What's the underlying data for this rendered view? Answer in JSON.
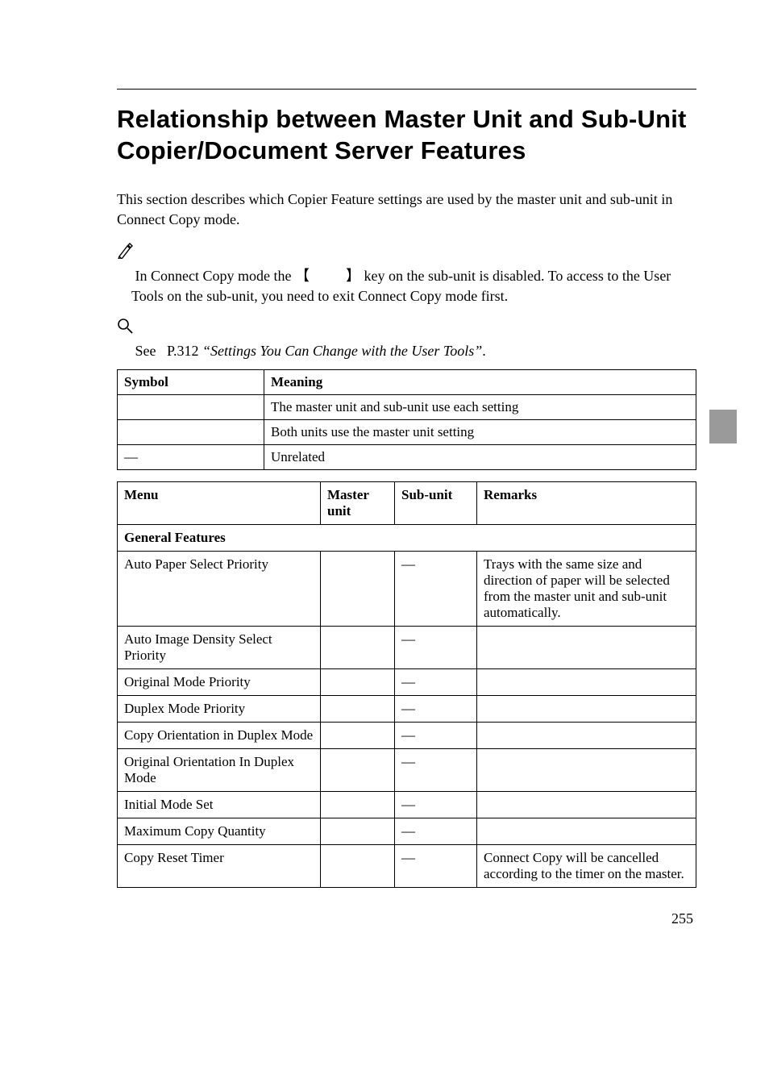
{
  "title": "Relationship between Master Unit and Sub-Unit Copier/Document Server Features",
  "intro": "This section describes which Copier Feature settings are used by the master unit and sub-unit in Connect Copy mode.",
  "note": {
    "pre": "In Connect Copy mode the ",
    "key_open": "【",
    "key_close": "】",
    "post": " key on the sub-unit is disabled. To access to the User Tools on the sub-unit, you need to exit Connect Copy mode first."
  },
  "reference": {
    "pre": "See ",
    "page": "P.312 ",
    "italic": "“Settings You Can Change with the User Tools”",
    "post": "."
  },
  "symbol_table": {
    "headers": {
      "c1": "Symbol",
      "c2": "Meaning"
    },
    "rows": [
      {
        "c1": "",
        "c2": "The master unit and sub-unit use each setting"
      },
      {
        "c1": "",
        "c2": "Both units use the master unit setting"
      },
      {
        "c1": "—",
        "c2": "Unrelated"
      }
    ]
  },
  "menu_table": {
    "headers": {
      "c1": "Menu",
      "c2": "Master unit",
      "c3": "Sub-unit",
      "c4": "Remarks"
    },
    "section": " General Features",
    "rows": [
      {
        "c1": "Auto Paper Select Priority",
        "c2": "",
        "c3": "—",
        "c4": "Trays with the same size and direction of paper will be selected from the master unit and sub-unit automatically."
      },
      {
        "c1": "Auto Image Density Select Priority",
        "c2": "",
        "c3": "—",
        "c4": ""
      },
      {
        "c1": "Original Mode Priority",
        "c2": "",
        "c3": "—",
        "c4": ""
      },
      {
        "c1": "Duplex Mode Priority",
        "c2": "",
        "c3": "—",
        "c4": ""
      },
      {
        "c1": "Copy Orientation in Duplex Mode",
        "c2": "",
        "c3": "—",
        "c4": ""
      },
      {
        "c1": "Original Orientation In Duplex Mode",
        "c2": "",
        "c3": "—",
        "c4": ""
      },
      {
        "c1": "Initial Mode Set",
        "c2": "",
        "c3": "—",
        "c4": ""
      },
      {
        "c1": "Maximum Copy Quantity",
        "c2": "",
        "c3": "—",
        "c4": ""
      },
      {
        "c1": "Copy Reset Timer",
        "c2": "",
        "c3": "—",
        "c4": "Connect Copy will be cancelled according to the timer on the master."
      }
    ]
  },
  "page_number": "255"
}
